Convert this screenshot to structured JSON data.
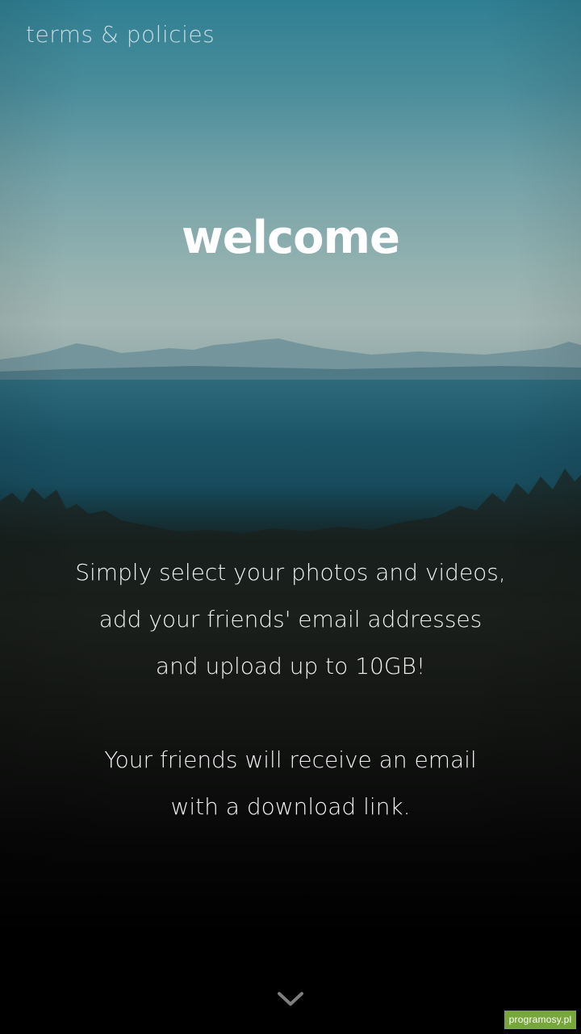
{
  "header": {
    "terms_link": "terms & policies"
  },
  "logo": {
    "text": "welcome"
  },
  "intro": {
    "line1": "Simply select your photos and videos,",
    "line2": "add your friends' email addresses",
    "line3": "and upload up to 10GB!",
    "line4": "Your friends will receive an email",
    "line5": "with a download link."
  },
  "footer": {
    "scroll_icon": "chevron-down-icon"
  },
  "watermark": {
    "text": "programosy.pl"
  },
  "colors": {
    "sky_top": "#2f7f93",
    "horizon": "#a3b7b3",
    "sea": "#1c5568",
    "ground": "#111311",
    "text": "#ffffff",
    "watermark_bg": "#77a63a"
  }
}
